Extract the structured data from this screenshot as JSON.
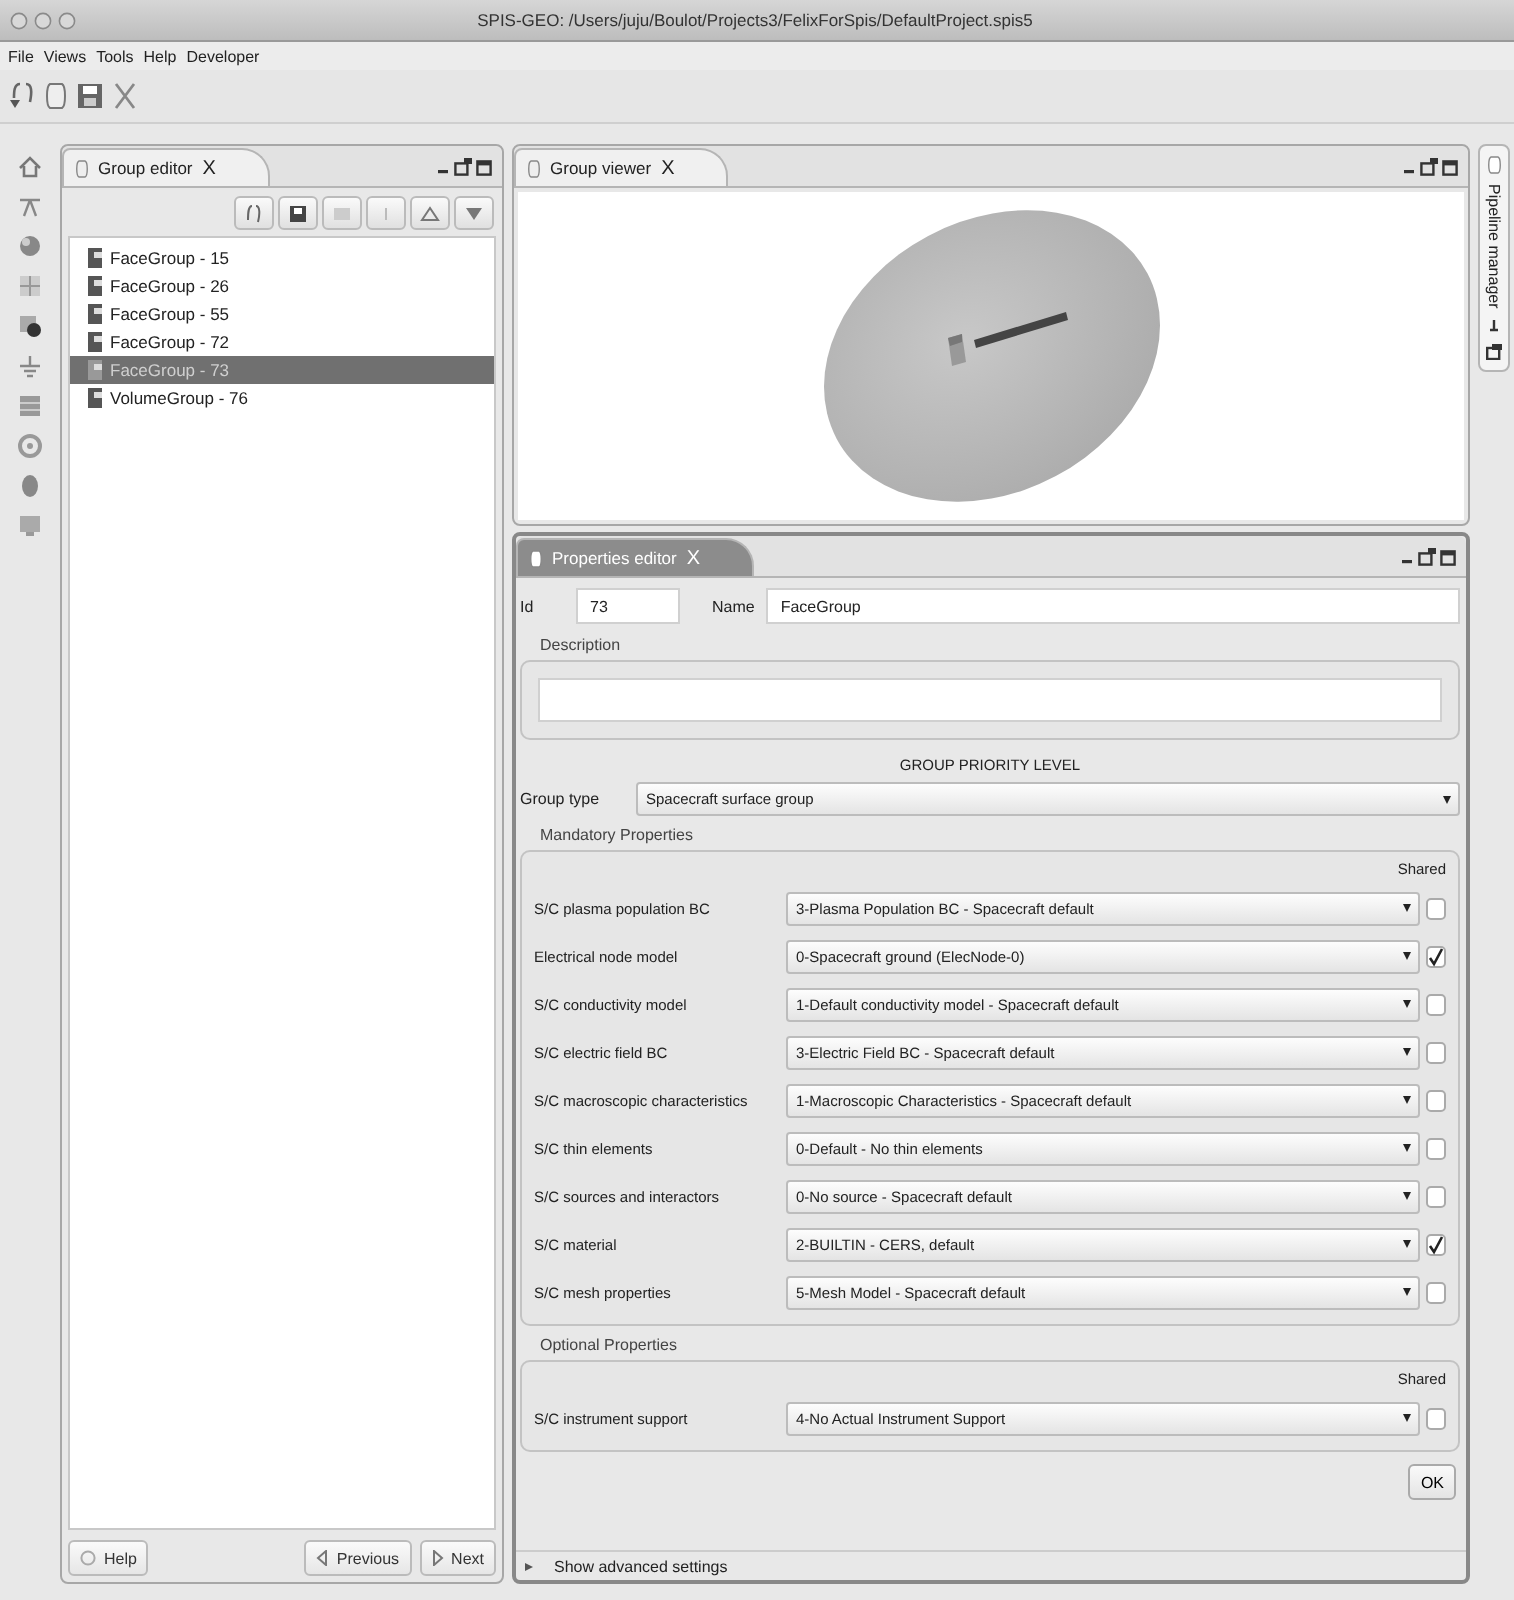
{
  "window": {
    "title": "SPIS-GEO: /Users/juju/Boulot/Projects3/FelixForSpis/DefaultProject.spis5"
  },
  "menu": [
    "File",
    "Views",
    "Tools",
    "Help",
    "Developer"
  ],
  "group_editor": {
    "title": "Group editor",
    "close": "X",
    "active": false,
    "items": [
      {
        "label": "FaceGroup - 15",
        "selected": false
      },
      {
        "label": "FaceGroup - 26",
        "selected": false
      },
      {
        "label": "FaceGroup - 55",
        "selected": false
      },
      {
        "label": "FaceGroup - 72",
        "selected": false
      },
      {
        "label": "FaceGroup - 73",
        "selected": true
      },
      {
        "label": "VolumeGroup - 76",
        "selected": false
      }
    ],
    "help": "Help",
    "previous": "Previous",
    "next": "Next"
  },
  "group_viewer": {
    "title": "Group viewer",
    "close": "X",
    "active": false
  },
  "pipeline_manager": {
    "title": "Pipeline manager"
  },
  "properties_editor": {
    "title": "Properties editor",
    "close": "X",
    "active": true,
    "id": {
      "label": "Id",
      "value": "73"
    },
    "name": {
      "label": "Name",
      "value": "FaceGroup"
    },
    "description": {
      "label": "Description"
    },
    "priority_heading": "GROUP PRIORITY LEVEL",
    "group_type": {
      "label": "Group type",
      "value": "Spacecraft surface group"
    },
    "mandatory": {
      "title": "Mandatory Properties",
      "shared_label": "Shared",
      "rows": [
        {
          "label": "S/C plasma population BC",
          "value": "3-Plasma Population BC - Spacecraft default",
          "shared": false
        },
        {
          "label": "Electrical node model",
          "value": "0-Spacecraft ground (ElecNode-0)",
          "shared": true
        },
        {
          "label": "S/C conductivity model",
          "value": "1-Default conductivity model - Spacecraft default",
          "shared": false
        },
        {
          "label": "S/C electric field BC",
          "value": "3-Electric Field BC - Spacecraft default",
          "shared": false
        },
        {
          "label": "S/C macroscopic characteristics",
          "value": "1-Macroscopic Characteristics - Spacecraft default",
          "shared": false
        },
        {
          "label": "S/C thin elements",
          "value": "0-Default - No thin elements",
          "shared": false
        },
        {
          "label": "S/C sources and interactors",
          "value": "0-No source - Spacecraft default",
          "shared": false
        },
        {
          "label": "S/C material",
          "value": "2-BUILTIN - CERS, default",
          "shared": true
        },
        {
          "label": "S/C mesh properties",
          "value": "5-Mesh Model - Spacecraft default",
          "shared": false
        }
      ]
    },
    "optional": {
      "title": "Optional Properties",
      "shared_label": "Shared",
      "rows": [
        {
          "label": "S/C instrument support",
          "value": "4-No Actual Instrument Support",
          "shared": false
        }
      ]
    },
    "ok": "OK",
    "advanced": {
      "label": "Show advanced settings",
      "expanded": false
    }
  }
}
